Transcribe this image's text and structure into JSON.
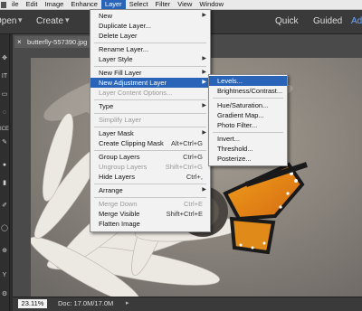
{
  "menubar": {
    "items": [
      "ile",
      "Edit",
      "Image",
      "Enhance",
      "Layer",
      "Select",
      "Filter",
      "View",
      "Window"
    ]
  },
  "toolbar": {
    "open": "Open",
    "create": "Create",
    "quick": "Quick",
    "guided": "Guided",
    "advanced": "Adv"
  },
  "toolstrip": {
    "labels": [
      "IT",
      "ICE",
      "Y"
    ]
  },
  "document": {
    "tab": "butterfly-557390.jpg @ 23.1",
    "zoom": "23.11%",
    "info": "Doc: 17.0M/17.0M"
  },
  "layer_menu": {
    "items": [
      {
        "label": "New",
        "arrow": true
      },
      {
        "label": "Duplicate Layer..."
      },
      {
        "label": "Delete Layer"
      },
      {
        "label": "Rename Layer..."
      },
      {
        "label": "Layer Style",
        "arrow": true
      },
      {
        "label": "New Fill Layer",
        "arrow": true
      },
      {
        "label": "New Adjustment Layer",
        "arrow": true,
        "highlighted": true
      },
      {
        "label": "Layer Content Options...",
        "disabled": true
      },
      {
        "label": "Type",
        "arrow": true
      },
      {
        "label": "Simplify Layer",
        "disabled": true
      },
      {
        "label": "Layer Mask",
        "arrow": true
      },
      {
        "label": "Create Clipping Mask",
        "shortcut": "Alt+Ctrl+G"
      },
      {
        "label": "Group Layers",
        "shortcut": "Ctrl+G"
      },
      {
        "label": "Ungroup Layers",
        "shortcut": "Shift+Ctrl+G",
        "disabled": true
      },
      {
        "label": "Hide Layers",
        "shortcut": "Ctrl+,"
      },
      {
        "label": "Arrange",
        "arrow": true
      },
      {
        "label": "Merge Down",
        "shortcut": "Ctrl+E",
        "disabled": true
      },
      {
        "label": "Merge Visible",
        "shortcut": "Shift+Ctrl+E"
      },
      {
        "label": "Flatten Image"
      }
    ]
  },
  "adjustment_submenu": {
    "items": [
      {
        "label": "Levels...",
        "highlighted": true
      },
      {
        "label": "Brightness/Contrast..."
      },
      {
        "label": "Hue/Saturation..."
      },
      {
        "label": "Gradient Map..."
      },
      {
        "label": "Photo Filter..."
      },
      {
        "label": "Invert..."
      },
      {
        "label": "Threshold..."
      },
      {
        "label": "Posterize..."
      }
    ]
  }
}
